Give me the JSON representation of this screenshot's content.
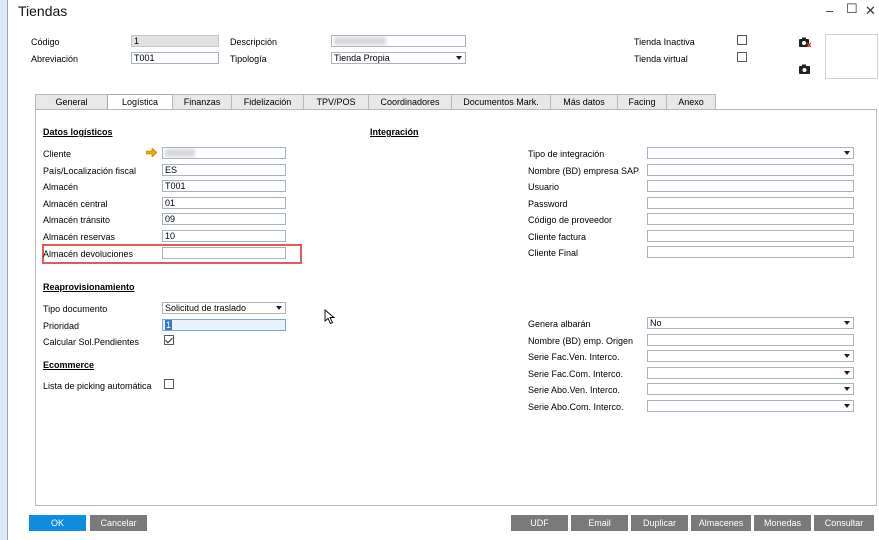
{
  "window": {
    "title": "Tiendas",
    "minimize_icon": "minimize-icon",
    "maximize_icon": "maximize-icon",
    "close_icon": "close-icon"
  },
  "header": {
    "codigo_label": "Código",
    "codigo_value": "1",
    "abreviacion_label": "Abreviación",
    "abreviacion_value": "T001",
    "descripcion_label": "Descripción",
    "tipologia_label": "Tipología",
    "tipologia_value": "Tienda Propia",
    "tienda_inactiva_label": "Tienda Inactiva",
    "tienda_inactiva_checked": false,
    "tienda_virtual_label": "Tienda virtual",
    "tienda_virtual_checked": false
  },
  "tabs": [
    {
      "label": "General",
      "active": false
    },
    {
      "label": "Logística",
      "active": true
    },
    {
      "label": "Finanzas",
      "active": false
    },
    {
      "label": "Fidelización",
      "active": false
    },
    {
      "label": "TPV/POS",
      "active": false
    },
    {
      "label": "Coordinadores",
      "active": false
    },
    {
      "label": "Documentos Mark.",
      "active": false
    },
    {
      "label": "Más datos",
      "active": false
    },
    {
      "label": "Facing",
      "active": false
    },
    {
      "label": "Anexo",
      "active": false
    }
  ],
  "logistica": {
    "section_title": "Datos logísticos",
    "cliente_label": "Cliente",
    "pais_label": "País/Localización fiscal",
    "pais_value": "ES",
    "almacen_label": "Almacén",
    "almacen_value": "T001",
    "almacen_central_label": "Almacén central",
    "almacen_central_value": "01",
    "almacen_transito_label": "Almacén tránsito",
    "almacen_transito_value": "09",
    "almacen_reservas_label": "Almacén reservas",
    "almacen_reservas_value": "10",
    "almacen_devoluciones_label": "Almacén devoluciones",
    "almacen_devoluciones_value": ""
  },
  "reaprov": {
    "section_title": "Reaprovisionamiento",
    "tipo_doc_label": "Tipo documento",
    "tipo_doc_value": "Solicitud de traslado",
    "prioridad_label": "Prioridad",
    "prioridad_value": "1",
    "calcular_label": "Calcular Sol.Pendientes",
    "calcular_checked": true
  },
  "ecommerce": {
    "section_title": "Ecommerce",
    "picking_label": "Lista de picking automática",
    "picking_checked": false
  },
  "integracion": {
    "section_title": "Integración",
    "tipo_label": "Tipo de integración",
    "nombre_bd_label": "Nombre (BD) empresa SAP",
    "usuario_label": "Usuario",
    "password_label": "Password",
    "codigo_prov_label": "Código de proveedor",
    "cliente_factura_label": "Cliente factura",
    "cliente_final_label": "Cliente Final",
    "genera_albaran_label": "Genera albarán",
    "genera_albaran_value": "No",
    "nombre_emp_origen_label": "Nombre (BD) emp. Origen",
    "serie_fac_ven_label": "Serie Fac.Ven. Interco.",
    "serie_fac_com_label": "Serie Fac.Com. Interco.",
    "serie_abo_ven_label": "Serie Abo.Ven. Interco.",
    "serie_abo_com_label": "Serie Abo.Com. Interco."
  },
  "footer": {
    "ok": "OK",
    "cancelar": "Cancelar",
    "udf": "UDF",
    "email": "Email",
    "duplicar": "Duplicar",
    "almacenes": "Almacenes",
    "monedas": "Monedas",
    "consultar": "Consultar"
  },
  "colors": {
    "ok_button": "#0f8de0",
    "gray_button": "#7a7a7a",
    "highlight_border": "#e35a5a",
    "link_arrow": "#f0a800"
  }
}
